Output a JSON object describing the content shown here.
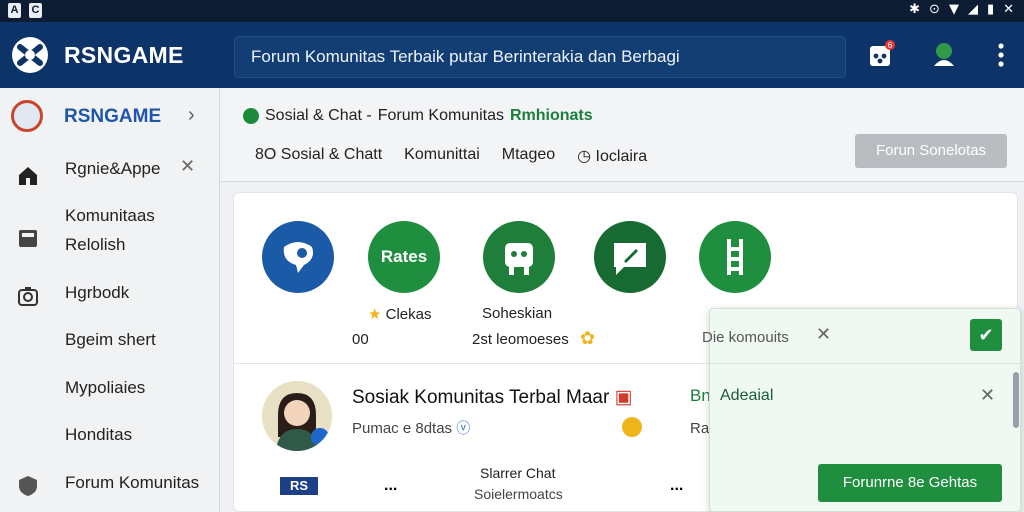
{
  "status": {
    "right_icons": [
      "✱",
      "⊙",
      "▼",
      "◢",
      "▮",
      "✕"
    ]
  },
  "appbar": {
    "title": "RSNGAME",
    "search_text": "Forum Komunitas Terbaik putar Berinterakia dan Berbagi",
    "notif_badge": "6"
  },
  "sidebar": {
    "header": "RSNGAME",
    "items": [
      {
        "label": "Rgnie&Appe",
        "icon": "home-icon"
      },
      {
        "label": "Komunitaas",
        "icon": ""
      },
      {
        "label": "Relolish",
        "icon": "book-icon"
      },
      {
        "label": "Hgrbodk",
        "icon": "camera-icon"
      },
      {
        "label": "Bgeim shert",
        "icon": ""
      },
      {
        "label": "Mypoliaies",
        "icon": ""
      },
      {
        "label": "Honditas",
        "icon": ""
      },
      {
        "label": "Forum Komunitas",
        "icon": "shield-icon"
      }
    ]
  },
  "subheader": {
    "crumb_prefix": "Sosial & Chat -",
    "crumb_main": "Forum Komunitas",
    "crumb_green": "Rmhionats",
    "tabs": [
      "8O Sosial & Chatt",
      "Komunittai",
      "Mtageo",
      "Ioclaira"
    ],
    "button": "Forun Sonelotas"
  },
  "card": {
    "categories": [
      {
        "icon_text": "",
        "label": "Clekas",
        "count": "00"
      },
      {
        "icon_text": "Rates",
        "label": "Soheskian",
        "count": "2st leomoeses"
      },
      {
        "icon_text": "",
        "label": "",
        "count": ""
      },
      {
        "icon_text": "",
        "label": "",
        "count": "Die komouits"
      },
      {
        "icon_text": "",
        "label": "",
        "count": ""
      }
    ],
    "post": {
      "title": "Sosiak Komunitas Terbal Maar",
      "sub": "Pumac e 8dtas",
      "side_title": "Bnl",
      "side_sub": "Ral"
    },
    "footer": {
      "logo_text": "RS",
      "center_title": "Slarrer Chat",
      "center_sub": "Soielermoatcs",
      "more": "..."
    }
  },
  "panel": {
    "item1": "Die komouits",
    "item2": "Adeaial",
    "button": "Forunrne 8e Gehtas"
  },
  "colors": {
    "appbar": "#0d3468",
    "accent_green": "#1f8f3f",
    "accent_blue": "#1e56a8"
  }
}
